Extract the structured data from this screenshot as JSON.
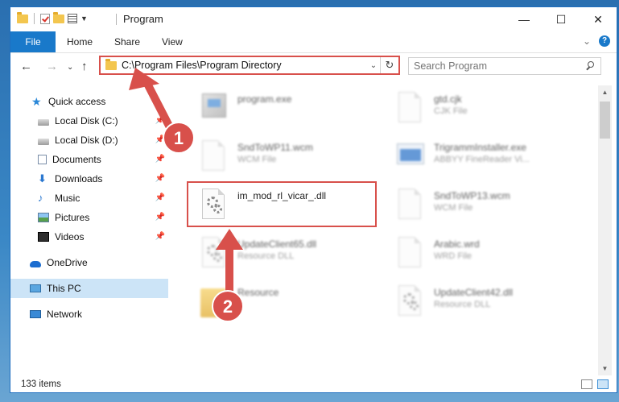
{
  "window": {
    "title": "Program",
    "controls": {
      "minimize": "—",
      "maximize": "☐",
      "close": "✕"
    }
  },
  "ribbon": {
    "tabs": [
      "File",
      "Home",
      "Share",
      "View"
    ],
    "collapse_glyph": "⌄",
    "help_glyph": "?"
  },
  "address": {
    "path": "C:\\Program Files\\Program Directory",
    "dropdown_glyph": "⌄",
    "refresh_glyph": "↻",
    "nav": {
      "back": "←",
      "forward": "→",
      "recent": "⌄",
      "up": "↑"
    }
  },
  "search": {
    "placeholder": "Search Program"
  },
  "sidebar": {
    "items": [
      {
        "label": "Quick access",
        "icon": "star-icon",
        "pinned": false
      },
      {
        "label": "Local Disk (C:)",
        "icon": "disk-icon",
        "pinned": true
      },
      {
        "label": "Local Disk (D:)",
        "icon": "disk-icon",
        "pinned": true
      },
      {
        "label": "Documents",
        "icon": "documents-icon",
        "pinned": true
      },
      {
        "label": "Downloads",
        "icon": "downloads-icon",
        "pinned": true
      },
      {
        "label": "Music",
        "icon": "music-icon",
        "pinned": true
      },
      {
        "label": "Pictures",
        "icon": "pictures-icon",
        "pinned": true
      },
      {
        "label": "Videos",
        "icon": "videos-icon",
        "pinned": true
      },
      {
        "label": "OneDrive",
        "icon": "onedrive-icon",
        "pinned": false
      },
      {
        "label": "This PC",
        "icon": "pc-icon",
        "pinned": false,
        "selected": true
      },
      {
        "label": "Network",
        "icon": "network-icon",
        "pinned": false
      }
    ]
  },
  "files": [
    {
      "name": "program.exe",
      "type": "",
      "icon": "exe-icon"
    },
    {
      "name": "gtd.cjk",
      "type": "CJK File",
      "icon": "document-icon"
    },
    {
      "name": "SndToWP11.wcm",
      "type": "WCM File",
      "icon": "document-icon"
    },
    {
      "name": "TrigrammInstaller.exe",
      "type": "ABBYY FineReader Vi...",
      "icon": "window-icon"
    },
    {
      "name": "im_mod_rl_vicar_.dll",
      "type": "",
      "icon": "dll-gear-icon",
      "highlighted": true
    },
    {
      "name": "SndToWP13.wcm",
      "type": "WCM File",
      "icon": "document-icon"
    },
    {
      "name": "UpdateClient65.dll",
      "type": "Resource DLL",
      "icon": "dll-gear-icon"
    },
    {
      "name": "Arabic.wrd",
      "type": "WRD File",
      "icon": "document-icon"
    },
    {
      "name": "Resource",
      "type": "",
      "icon": "folder-icon"
    },
    {
      "name": "UpdateClient42.dll",
      "type": "Resource DLL",
      "icon": "dll-gear-icon"
    }
  ],
  "status": {
    "item_count": "133 items"
  },
  "annotations": [
    {
      "label": "1"
    },
    {
      "label": "2"
    }
  ],
  "colors": {
    "accent": "#1979ca",
    "highlight_border": "#d8504b",
    "annotation": "#d8504b",
    "selected_bg": "#cce4f7"
  }
}
